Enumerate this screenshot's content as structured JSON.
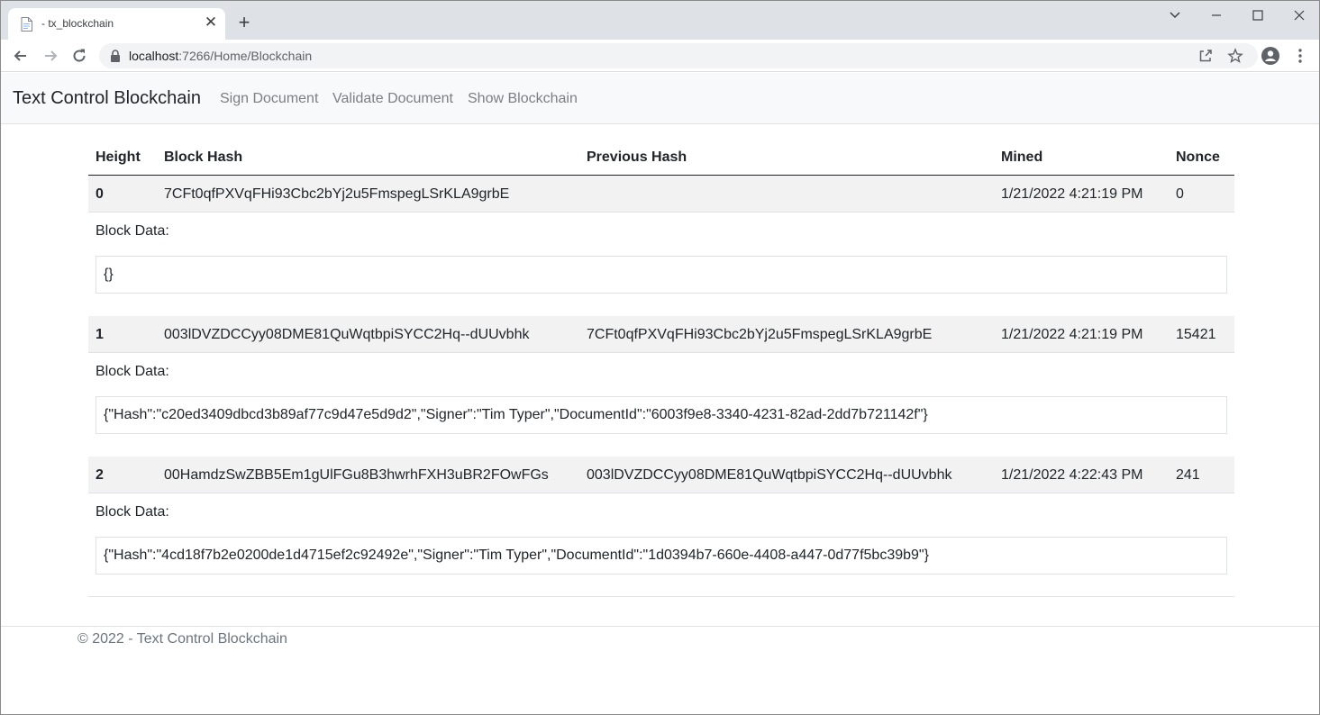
{
  "browser": {
    "tab_title": "- tx_blockchain",
    "url_host": "localhost",
    "url_path": ":7266/Home/Blockchain"
  },
  "nav": {
    "brand": "Text Control Blockchain",
    "links": [
      "Sign Document",
      "Validate Document",
      "Show Blockchain"
    ]
  },
  "table": {
    "headers": [
      "Height",
      "Block Hash",
      "Previous Hash",
      "Mined",
      "Nonce"
    ],
    "data_label": "Block Data:",
    "blocks": [
      {
        "height": "0",
        "hash": "7CFt0qfPXVqFHi93Cbc2bYj2u5FmspegLSrKLA9grbE",
        "previous_hash": "",
        "mined": "1/21/2022 4:21:19 PM",
        "nonce": "0",
        "data": "{}"
      },
      {
        "height": "1",
        "hash": "003lDVZDCCyy08DME81QuWqtbpiSYCC2Hq--dUUvbhk",
        "previous_hash": "7CFt0qfPXVqFHi93Cbc2bYj2u5FmspegLSrKLA9grbE",
        "mined": "1/21/2022 4:21:19 PM",
        "nonce": "15421",
        "data": "{\"Hash\":\"c20ed3409dbcd3b89af77c9d47e5d9d2\",\"Signer\":\"Tim Typer\",\"DocumentId\":\"6003f9e8-3340-4231-82ad-2dd7b721142f\"}"
      },
      {
        "height": "2",
        "hash": "00HamdzSwZBB5Em1gUlFGu8B3hwrhFXH3uBR2FOwFGs",
        "previous_hash": "003lDVZDCCyy08DME81QuWqtbpiSYCC2Hq--dUUvbhk",
        "mined": "1/21/2022 4:22:43 PM",
        "nonce": "241",
        "data": "{\"Hash\":\"4cd18f7b2e0200de1d4715ef2c92492e\",\"Signer\":\"Tim Typer\",\"DocumentId\":\"1d0394b7-660e-4408-a447-0d77f5bc39b9\"}"
      }
    ]
  },
  "footer": {
    "text": "© 2022 - Text Control Blockchain"
  }
}
